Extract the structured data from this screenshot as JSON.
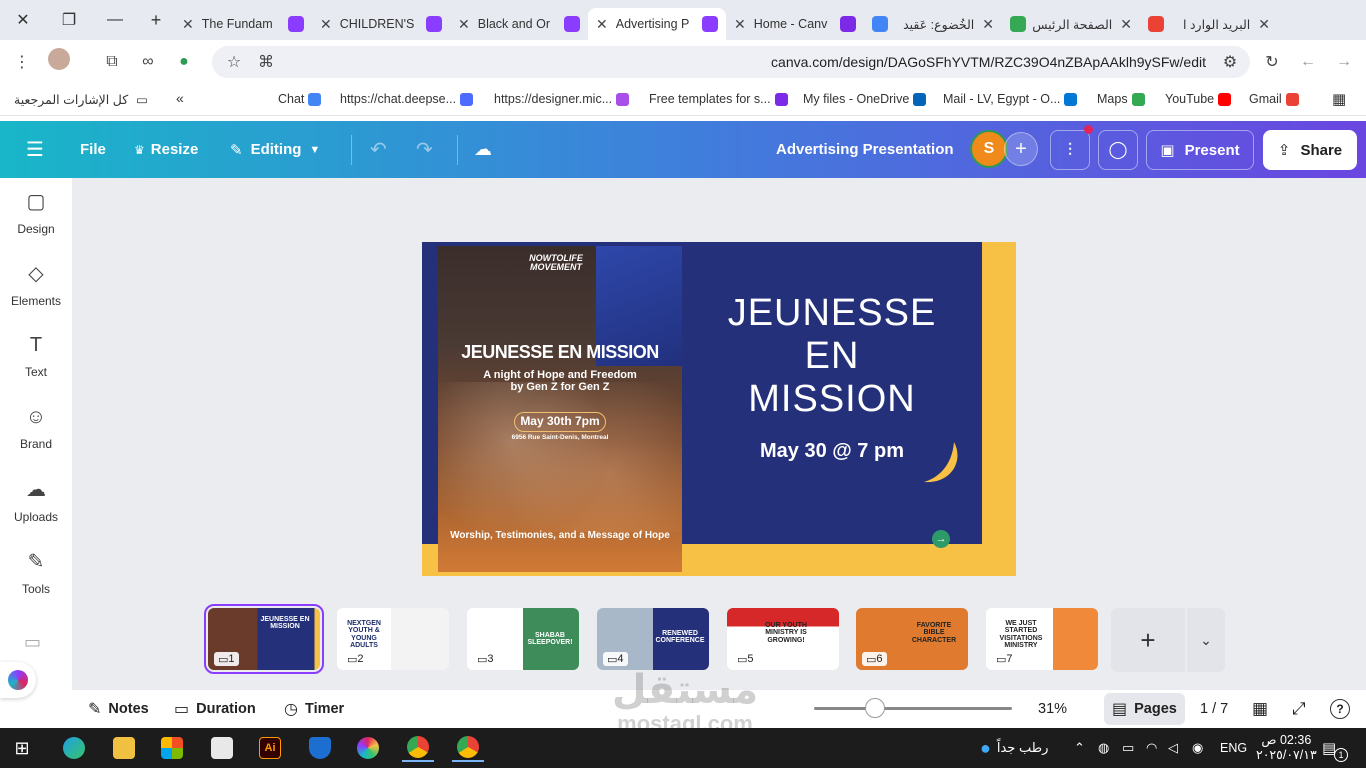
{
  "browser": {
    "window_close": "✕",
    "window_restore": "❐",
    "window_minimize": "—",
    "new_tab": "+",
    "tabs": [
      {
        "title": "The Fundam",
        "favicon_color": "#8b3dff",
        "rtl": false,
        "active": false
      },
      {
        "title": "CHILDREN'S",
        "favicon_color": "#8b3dff",
        "rtl": false,
        "active": false
      },
      {
        "title": "Black and Or",
        "favicon_color": "#8b3dff",
        "rtl": false,
        "active": false
      },
      {
        "title": "Advertising P",
        "favicon_color": "#8b3dff",
        "rtl": false,
        "active": true
      },
      {
        "title": "Home - Canv",
        "favicon_color": "#7d2ae8",
        "rtl": false,
        "active": false
      },
      {
        "title": "الخُضوع: عَقيد",
        "favicon_color": "#4285f4",
        "rtl": true,
        "active": false
      },
      {
        "title": "الصفحة الرئيس",
        "favicon_color": "#34a853",
        "rtl": true,
        "active": false
      },
      {
        "title": "البريد الوارد ا",
        "favicon_color": "#ea4335",
        "rtl": true,
        "active": false
      }
    ],
    "url": "canva.com/design/DAGoSFhYVTM/RZC39O4nZBApAAklh9ySFw/edit",
    "bookmarks": {
      "all_bookmarks": "كل الإشارات المرجعية",
      "overflow": "«",
      "items": [
        {
          "label": "Chat",
          "color": "#4285f4"
        },
        {
          "label": "https://chat.deepse...",
          "color": "#4d6bfe"
        },
        {
          "label": "https://designer.mic...",
          "color": "#a94ee8"
        },
        {
          "label": "Free templates for s...",
          "color": "#7d2ae8"
        },
        {
          "label": "My files - OneDrive",
          "color": "#0364b8"
        },
        {
          "label": "Mail - LV, Egypt - O...",
          "color": "#0078d4"
        },
        {
          "label": "Maps",
          "color": "#34a853"
        },
        {
          "label": "YouTube",
          "color": "#ff0000"
        },
        {
          "label": "Gmail",
          "color": "#ea4335"
        }
      ]
    }
  },
  "canva": {
    "header": {
      "menu_icon": "☰",
      "file": "File",
      "resize": "Resize",
      "editing": "Editing",
      "doc_title": "Advertising Presentation",
      "avatar_letter": "S",
      "present": "Present",
      "share": "Share",
      "gradient_start": "#19b6c8",
      "gradient_end": "#6a46e0"
    },
    "rail": [
      {
        "label": "Design",
        "icon": "▢"
      },
      {
        "label": "Elements",
        "icon": "◇"
      },
      {
        "label": "Text",
        "icon": "T"
      },
      {
        "label": "Brand",
        "icon": "☺"
      },
      {
        "label": "Uploads",
        "icon": "☁"
      },
      {
        "label": "Tools",
        "icon": "✎"
      }
    ],
    "slide": {
      "title_line1": "JEUNESSE",
      "title_line2": "EN",
      "title_line3": "MISSION",
      "date": "May 30 @ 7 pm",
      "navy": "#24307a",
      "accent": "#f7c145",
      "poster": {
        "brand": "NOWTOLIFE MOVEMENT",
        "title": "JEUNESSE EN MISSION",
        "subtitle": "A night of Hope and Freedom by Gen Z for Gen Z",
        "date": "May 30th 7pm",
        "address": "6956 Rue Saint-Denis, Montreal",
        "footer": "Worship, Testimonies, and a Message of Hope"
      }
    },
    "thumbnails": [
      {
        "num": "1",
        "text": "JEUNESSE EN MISSION"
      },
      {
        "num": "2",
        "text": "NEXTGEN YOUTH & YOUNG ADULTS"
      },
      {
        "num": "3",
        "text": "SHABAB SLEEPOVER!"
      },
      {
        "num": "4",
        "text": "RENEWED CONFERENCE"
      },
      {
        "num": "5",
        "text": "OUR YOUTH MINISTRY IS GROWING!"
      },
      {
        "num": "6",
        "text": "FAVORITE BIBLE CHARACTER"
      },
      {
        "num": "7",
        "text": "WE JUST STARTED VISITATIONS MINISTRY"
      }
    ],
    "add_page": "+",
    "bottom": {
      "notes": "Notes",
      "duration": "Duration",
      "timer": "Timer",
      "zoom": "31%",
      "zoom_level": 0.31,
      "pages": "Pages",
      "page_count": "1 / 7"
    }
  },
  "watermark": {
    "arabic": "مستقل",
    "latin": "mostaql.com"
  },
  "taskbar": {
    "weather": "رطب جداً",
    "lang": "ENG",
    "time": "02:36 ص",
    "date": "٢٠٢٥/٠٧/١٣",
    "notif_count": "1"
  }
}
